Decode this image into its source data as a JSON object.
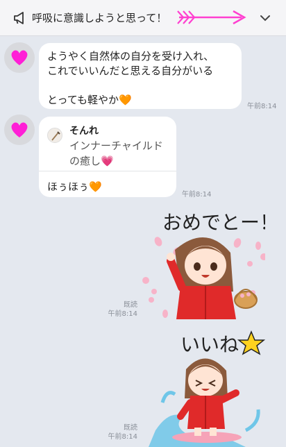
{
  "announcement": {
    "text": "呼吸に意識しようと思って！",
    "megaphone_icon": "megaphone-icon",
    "arrow_icon": "cupid-arrow-icon",
    "chevron_icon": "chevron-down-icon",
    "arrow_color": "#ff3fd0"
  },
  "colors": {
    "background": "#e4e8ef",
    "bubble": "#ffffff",
    "avatar_heart": "#ff1fd6",
    "orange_heart": "#ff8a1c"
  },
  "messages": {
    "m1": {
      "lines": [
        "ようやく自然体の自分を受け入れ、",
        "これでいいんだと思える自分がいる",
        "",
        "とっても軽やか🧡"
      ],
      "time": "午前8:14"
    },
    "m2": {
      "quote_name": "そんれ",
      "quote_text_1": "インナーチャイルド",
      "quote_text_2": "の癒し💗",
      "reply": "ほぅほぅ🧡",
      "time": "午前8:14"
    },
    "s1": {
      "caption": "おめでとー！",
      "read": "既読",
      "time": "午前8:14"
    },
    "s2": {
      "caption": "いいね",
      "read": "既読",
      "time": "午前8:14"
    }
  }
}
